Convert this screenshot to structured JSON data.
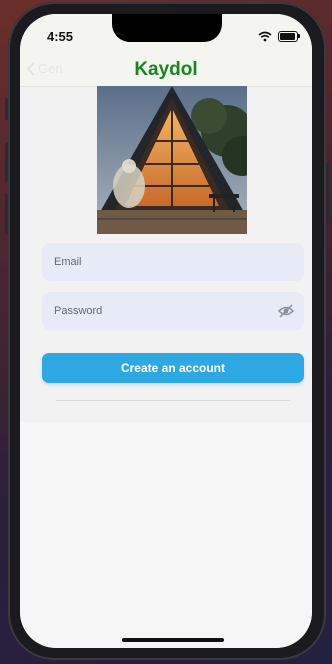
{
  "status_bar": {
    "time": "4:55"
  },
  "nav": {
    "back_label": "Gen",
    "title": "Kaydol"
  },
  "hero": {
    "alt": "A-frame cabin photo"
  },
  "form": {
    "email_placeholder": "Email",
    "password_placeholder": "Password",
    "submit_label": "Create an account"
  },
  "colors": {
    "title_green": "#17861f",
    "primary_button": "#2ea8e2",
    "field_bg": "#e7ebf5"
  }
}
